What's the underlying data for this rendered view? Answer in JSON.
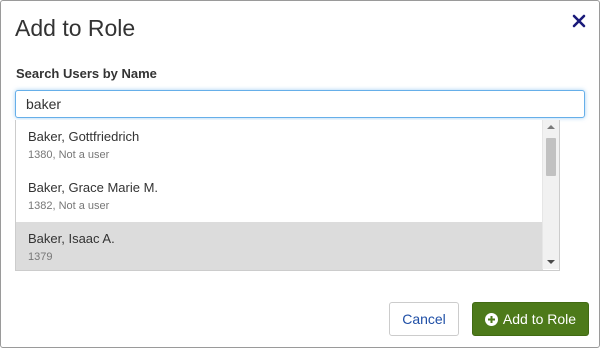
{
  "modal": {
    "title": "Add to Role",
    "close_icon": "close-x-icon"
  },
  "search": {
    "label": "Search Users by Name",
    "value": "baker"
  },
  "results": [
    {
      "name": "Baker, Gottfriedrich",
      "detail": "1380, Not a user",
      "highlighted": false
    },
    {
      "name": "Baker, Grace Marie M.",
      "detail": "1382, Not a user",
      "highlighted": false
    },
    {
      "name": "Baker, Isaac A.",
      "detail": "1379",
      "highlighted": true
    }
  ],
  "buttons": {
    "cancel_label": "Cancel",
    "add_label": "Add to Role",
    "add_icon": "plus-circle-icon"
  },
  "colors": {
    "primary_green": "#4d7a1a",
    "link_blue": "#1f4fa6",
    "close_navy": "#1a1a7a",
    "highlight_gray": "#dcdcdc"
  }
}
